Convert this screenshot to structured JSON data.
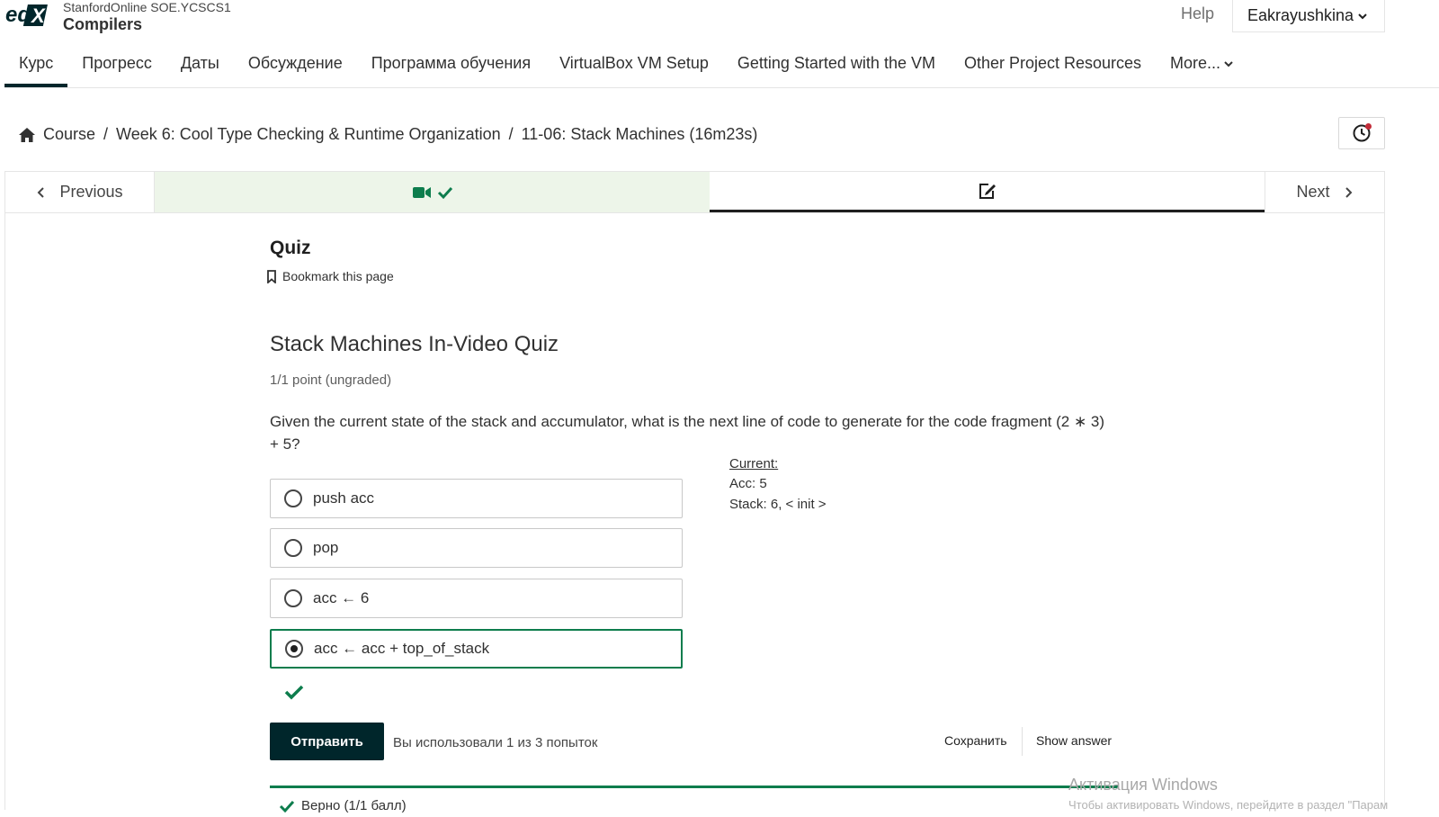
{
  "header": {
    "logo_text": "edX",
    "org": "StanfordOnline SOE.YCSCS1",
    "course": "Compilers",
    "help": "Help",
    "user": "Eakrayushkina"
  },
  "nav": {
    "tabs": [
      {
        "label": "Курс"
      },
      {
        "label": "Прогресс"
      },
      {
        "label": "Даты"
      },
      {
        "label": "Обсуждение"
      },
      {
        "label": "Программа обучения"
      },
      {
        "label": "VirtualBox VM Setup"
      },
      {
        "label": "Getting Started with the VM"
      },
      {
        "label": "Other Project Resources"
      },
      {
        "label": "More..."
      }
    ]
  },
  "breadcrumb": {
    "items": [
      "Course",
      "Week 6: Cool Type Checking & Runtime Organization",
      "11-06: Stack Machines (16m23s)"
    ],
    "separator": "/"
  },
  "sequence": {
    "previous": "Previous",
    "next": "Next"
  },
  "unit": {
    "title": "Quiz",
    "bookmark": "Bookmark this page"
  },
  "problem": {
    "title": "Stack Machines In-Video Quiz",
    "points": "1/1 point (ungraded)",
    "question": "Given the current state of the stack and accumulator, what is the next line of code to generate for the code fragment (2 ∗ 3) + 5?",
    "options": [
      {
        "label": "push acc",
        "selected": false
      },
      {
        "label": "pop",
        "selected": false
      },
      {
        "label": "acc ← 6",
        "selected": false
      },
      {
        "label": "acc ← acc + top_of_stack",
        "selected": true
      }
    ],
    "current_heading": "Current:",
    "current_acc": "Acc: 5",
    "current_stack": "Stack: 6, < init >",
    "submit": "Отправить",
    "attempts": "Вы использовали 1 из 3 попыток",
    "save": "Сохранить",
    "show_answer": "Show answer",
    "feedback": "Верно (1/1 балл)"
  },
  "watermark": {
    "line1": "Активация Windows",
    "line2": "Чтобы активировать Windows, перейдите в раздел \"Парам"
  },
  "colors": {
    "brand_dark": "#00262b",
    "success": "#0d7d4d",
    "video_tab_bg": "#edf5e9"
  }
}
